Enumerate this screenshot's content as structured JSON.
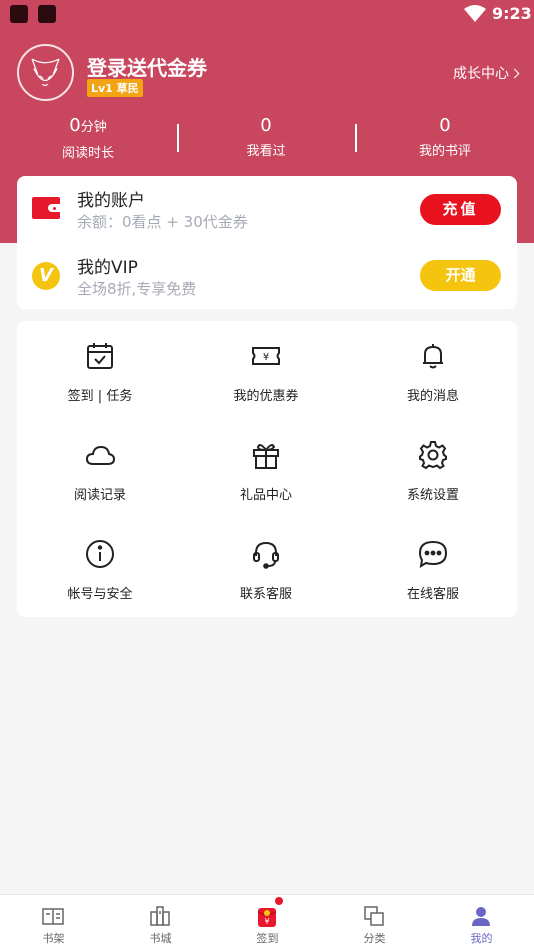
{
  "status_bar": {
    "time": "9:23"
  },
  "profile": {
    "title": "登录送代金券",
    "level_badge": "Lv1 草民",
    "growth_link": "成长中心"
  },
  "stats": [
    {
      "value": "0",
      "unit": "分钟",
      "label": "阅读时长"
    },
    {
      "value": "0",
      "unit": "",
      "label": "我看过"
    },
    {
      "value": "0",
      "unit": "",
      "label": "我的书评"
    }
  ],
  "account": {
    "title": "我的账户",
    "balance": "余额：0看点 + 30代金券",
    "button": "充值"
  },
  "vip": {
    "icon_letter": "V",
    "title": "我的VIP",
    "subtitle": "全场8折,专享免费",
    "button": "开通"
  },
  "menu": [
    {
      "label": "签到 | 任务",
      "icon": "calendar-check-icon"
    },
    {
      "label": "我的优惠券",
      "icon": "coupon-icon"
    },
    {
      "label": "我的消息",
      "icon": "bell-icon"
    },
    {
      "label": "阅读记录",
      "icon": "cloud-icon"
    },
    {
      "label": "礼品中心",
      "icon": "gift-icon"
    },
    {
      "label": "系统设置",
      "icon": "gear-icon"
    },
    {
      "label": "帐号与安全",
      "icon": "info-icon"
    },
    {
      "label": "联系客服",
      "icon": "headset-icon"
    },
    {
      "label": "在线客服",
      "icon": "chat-icon"
    }
  ],
  "tabs": [
    {
      "label": "书架",
      "icon": "bookshelf-icon"
    },
    {
      "label": "书城",
      "icon": "bookstore-icon"
    },
    {
      "label": "签到",
      "icon": "red-packet-icon"
    },
    {
      "label": "分类",
      "icon": "category-icon"
    },
    {
      "label": "我的",
      "icon": "user-icon"
    }
  ],
  "colors": {
    "header": "#c8465e",
    "recharge": "#e8121f",
    "vip": "#f4c40f",
    "active_tab": "#6a66c4"
  }
}
